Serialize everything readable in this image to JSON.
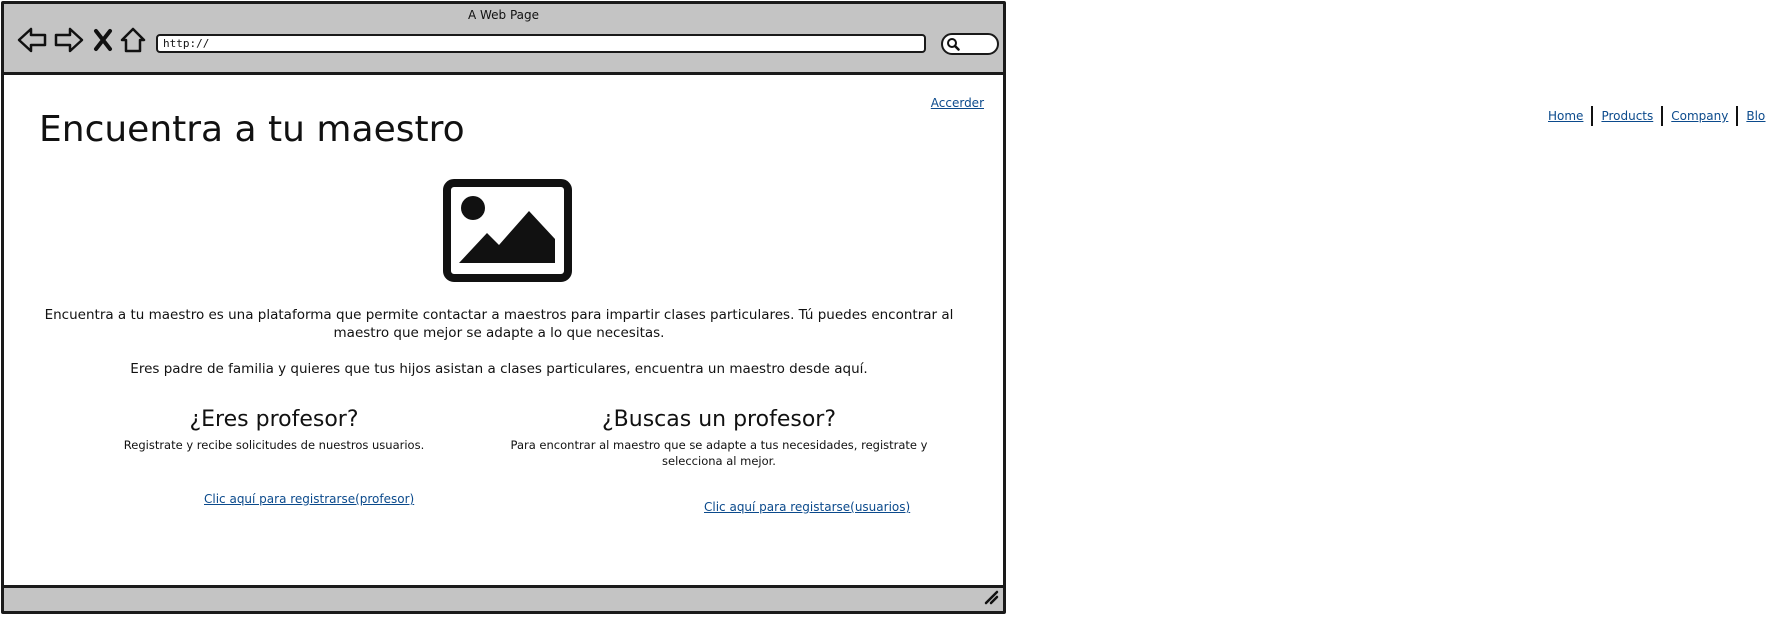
{
  "window": {
    "title": "A Web Page"
  },
  "address_bar": {
    "value": "http://"
  },
  "icons": {
    "back": "back-arrow-icon",
    "forward": "forward-arrow-icon",
    "close": "close-icon",
    "home": "home-icon",
    "search": "search-icon",
    "image": "image-placeholder-icon",
    "resize": "resize-grip-icon"
  },
  "header": {
    "login_link": "Accerder",
    "title": "Encuentra a tu maestro"
  },
  "intro": {
    "p1": "Encuentra a tu maestro es una plataforma que permite contactar a maestros para impartir clases particulares. Tú puedes encontrar al maestro que mejor se adapte a lo que necesitas.",
    "p2": "Eres padre de familia y quieres que tus hijos asistan a clases particulares, encuentra un maestro desde aquí."
  },
  "teacher": {
    "title": "¿Eres profesor?",
    "description": "Registrate y recibe solicitudes de nuestros usuarios.",
    "link": "Clic aquí para registrarse(profesor)"
  },
  "student": {
    "title": "¿Buscas un profesor?",
    "description": "Para encontrar al maestro que se adapte a tus necesidades, registrate y selecciona al mejor.",
    "link": "Clic aquí para registarse(usuarios)"
  },
  "top_nav": {
    "items": [
      "Home",
      "Products",
      "Company",
      "Blog"
    ]
  },
  "colors": {
    "link": "#0b4a8c",
    "chrome": "#c4c4c4",
    "border": "#1a1a1a"
  }
}
